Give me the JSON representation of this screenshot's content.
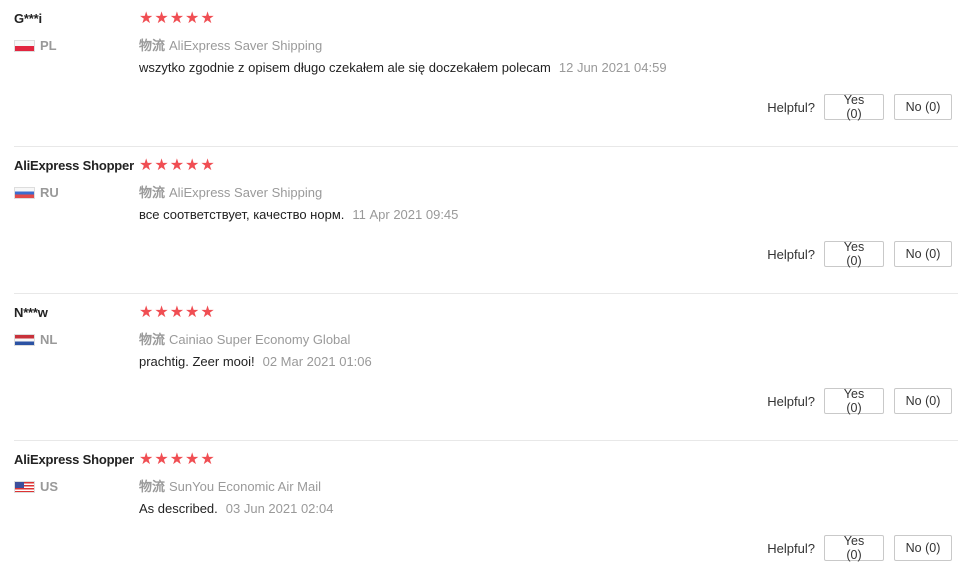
{
  "reviews": [
    {
      "buyer": "G***i",
      "country": "PL",
      "logistics_label": "物流",
      "logistics": "AliExpress Saver Shipping",
      "text": "wszytko zgodnie z opisem długo czekałem ale się doczekałem polecam",
      "date": "12 Jun 2021 04:59",
      "helpful_label": "Helpful?",
      "yes": "Yes (0)",
      "no": "No (0)",
      "rating": 5
    },
    {
      "buyer": "AliExpress Shopper",
      "country": "RU",
      "logistics_label": "物流",
      "logistics": "AliExpress Saver Shipping",
      "text": "все соответствует, качество норм.",
      "date": "11 Apr 2021 09:45",
      "helpful_label": "Helpful?",
      "yes": "Yes (0)",
      "no": "No (0)",
      "rating": 5
    },
    {
      "buyer": "N***w",
      "country": "NL",
      "logistics_label": "物流",
      "logistics": "Cainiao Super Economy Global",
      "text": "prachtig. Zeer mooi!",
      "date": "02 Mar 2021 01:06",
      "helpful_label": "Helpful?",
      "yes": "Yes (0)",
      "no": "No (0)",
      "rating": 5
    },
    {
      "buyer": "AliExpress Shopper",
      "country": "US",
      "logistics_label": "物流",
      "logistics": "SunYou Economic Air Mail",
      "text": "As described.",
      "date": "03 Jun 2021 02:04",
      "helpful_label": "Helpful?",
      "yes": "Yes (0)",
      "no": "No (0)",
      "rating": 5
    }
  ],
  "colors": {
    "star": "#f04e53",
    "muted_text": "#999999",
    "divider": "#e8e8e8"
  }
}
